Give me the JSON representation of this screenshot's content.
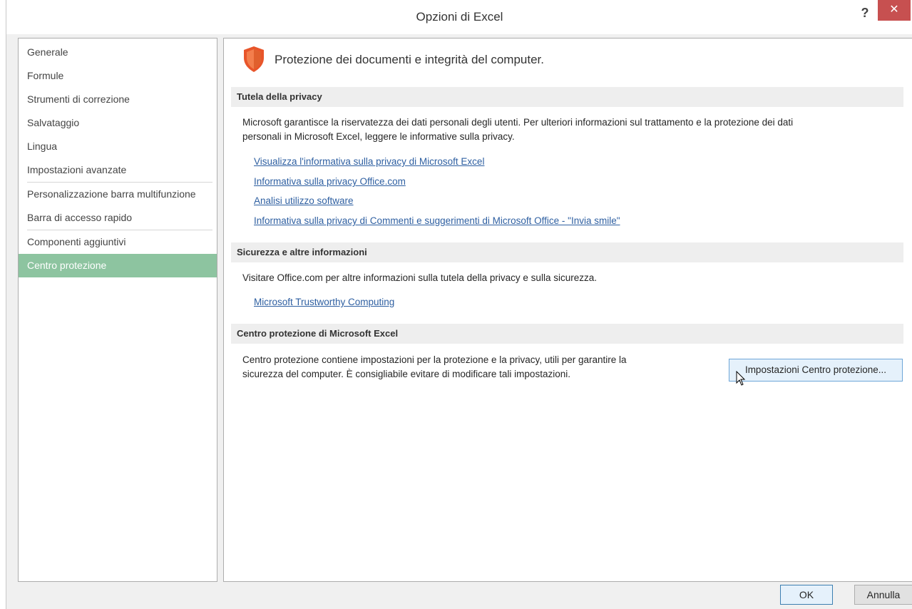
{
  "window": {
    "title": "Opzioni di Excel",
    "help_label": "?",
    "close_label": "✕"
  },
  "sidebar": {
    "items": [
      {
        "label": "Generale"
      },
      {
        "label": "Formule"
      },
      {
        "label": "Strumenti di correzione"
      },
      {
        "label": "Salvataggio"
      },
      {
        "label": "Lingua"
      },
      {
        "label": "Impostazioni avanzate"
      },
      {
        "label": "Personalizzazione barra multifunzione"
      },
      {
        "label": "Barra di accesso rapido"
      },
      {
        "label": "Componenti aggiuntivi"
      },
      {
        "label": "Centro protezione"
      }
    ],
    "selected": "Centro protezione"
  },
  "main": {
    "icon": "shield-icon",
    "title": "Protezione dei documenti e integrità del computer.",
    "privacy": {
      "header": "Tutela della privacy",
      "text_line1": "Microsoft garantisce la riservatezza dei dati personali degli utenti. Per ulteriori informazioni sul trattamento e la protezione dei dati",
      "text_line2": "personali in Microsoft Excel, leggere le informative sulla privacy.",
      "links": [
        "Visualizza l'informativa sulla privacy di Microsoft Excel",
        "Informativa sulla privacy Office.com",
        "Analisi utilizzo software",
        "Informativa sulla privacy di Commenti e suggerimenti di Microsoft Office - \"Invia smile\""
      ]
    },
    "security": {
      "header": "Sicurezza e altre informazioni",
      "text": "Visitare Office.com per altre informazioni sulla tutela della privacy e sulla sicurezza.",
      "link": "Microsoft Trustworthy Computing"
    },
    "trust_center": {
      "header": "Centro protezione di Microsoft Excel",
      "text_line1": "Centro protezione contiene impostazioni per la protezione e la privacy, utili per garantire la",
      "text_line2": "sicurezza del computer. È consigliabile evitare di modificare tali impostazioni.",
      "button": "Impostazioni Centro protezione..."
    }
  },
  "footer": {
    "ok": "OK",
    "cancel": "Annulla"
  },
  "colors": {
    "selected_nav": "#8dc4a0",
    "close_button": "#c75050",
    "link": "#2e5fa1",
    "shield": "#e8552a"
  }
}
